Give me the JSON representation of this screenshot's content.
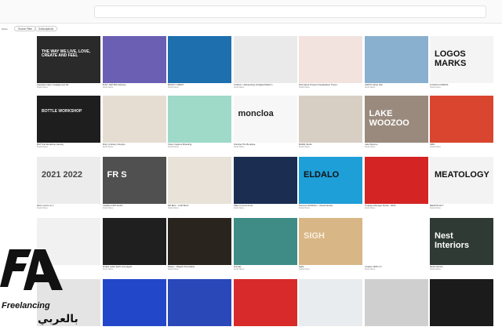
{
  "filters": {
    "left_label": "Show",
    "chip1": "Source Filter",
    "chip2": "Subscriptions"
  },
  "rows": [
    [
      {
        "icon": "collage-quote-image",
        "cap": "Aspiration take nostalgia and fell",
        "sub": "Studio Name",
        "bg": "#2a2a2a",
        "text": "THE WAY WE LIVE, LOVE, CREATE AND FEEL",
        "fg": "#ffffff"
      },
      {
        "icon": "packaging-image",
        "cap": "BUSY SET BIG Delivery",
        "sub": "Studio Name",
        "bg": "#6a5fb3",
        "text": "",
        "fg": "#fff"
      },
      {
        "icon": "business-cards-image",
        "cap": "BOOSY CREST",
        "sub": "Studio Name",
        "bg": "#1d6fae",
        "text": "",
        "fg": "#fff"
      },
      {
        "icon": "social-posts-image",
        "cap": "CODA K • Rebranding & Digital Platform",
        "sub": "Studio Name",
        "bg": "#eaeaea",
        "text": "",
        "fg": "#222"
      },
      {
        "icon": "product-render-image",
        "cap": "Pink Mood Product Visualization Travel",
        "sub": "Studio Name",
        "bg": "#f2e3df",
        "text": "",
        "fg": "#222"
      },
      {
        "icon": "street-building-image",
        "cap": "DAPFS Urban Hits",
        "sub": "Studio Name",
        "bg": "#8ab0cf",
        "text": "",
        "fg": "#fff"
      },
      {
        "icon": "logos-marks-image",
        "cap": "LOGOS & MARKS",
        "sub": "Studio Name",
        "bg": "#f4f4f4",
        "text": "LOGOS MARKS",
        "fg": "#111"
      }
    ],
    [
      {
        "icon": "workshop-image",
        "cap": "BOTTLE Workshop Identity",
        "sub": "Studio Name",
        "bg": "#1e1e1e",
        "text": "BOTTLE WORKSHOP",
        "fg": "#eeeeee"
      },
      {
        "icon": "ceramics-image",
        "cap": "Shiny Culinary Lifestyle",
        "sub": "Studio Name",
        "bg": "#e6ddd2",
        "text": "",
        "fg": "#222"
      },
      {
        "icon": "mascot-image",
        "cap": "Vision Capture Branding",
        "sub": "Studio Name",
        "bg": "#9fd9c8",
        "text": "",
        "fg": "#222"
      },
      {
        "icon": "moncloa-logo-image",
        "cap": "Moncloa The Boutique",
        "sub": "Studio Name",
        "bg": "#f7f7f7",
        "text": "moncloa",
        "fg": "#222"
      },
      {
        "icon": "jars-image",
        "cap": "MADE Studio",
        "sub": "Studio Name",
        "bg": "#d8cfc4",
        "text": "",
        "fg": "#222"
      },
      {
        "icon": "lake-woozoo-image",
        "cap": "Lake Woozoo",
        "sub": "Studio Name",
        "bg": "#9a8a7d",
        "text": "LAKE WOOZOO",
        "fg": "#ffffff"
      },
      {
        "icon": "phone-app-image",
        "cap": "SMS",
        "sub": "Studio Name",
        "bg": "#d9452e",
        "text": "",
        "fg": "#fff"
      }
    ],
    [
      {
        "icon": "year-circle-image",
        "cap": "2021 events on 1",
        "sub": "Studio Name",
        "bg": "#ececec",
        "text": "2021 2022",
        "fg": "#444"
      },
      {
        "icon": "frs-logo-image",
        "cap": "Facilities FRS Studio",
        "sub": "Studio Name",
        "bg": "#505050",
        "text": "FR S",
        "fg": "#ffffff"
      },
      {
        "icon": "book-spread-image",
        "cap": "NR Best - Craft Book",
        "sub": "Studio Name",
        "bg": "#e8e2d8",
        "text": "",
        "fg": "#222"
      },
      {
        "icon": "pattern-cards-image",
        "cap": "Make It Come Fund",
        "sub": "Studio Name",
        "bg": "#1c2d52",
        "text": "",
        "fg": "#fff"
      },
      {
        "icon": "poster-image",
        "cap": "Summer Exhibition - Visual Identity",
        "sub": "Studio Name",
        "bg": "#1e9fd8",
        "text": "ELDALO",
        "fg": "#111"
      },
      {
        "icon": "red-form-image",
        "cap": "Prokapred Design Studio - 2023",
        "sub": "Studio Name",
        "bg": "#d42424",
        "text": "",
        "fg": "#fff"
      },
      {
        "icon": "meatology-image",
        "cap": "MEATOLOGY",
        "sub": "Studio Name",
        "bg": "#f3f3f3",
        "text": "MEATOLOGY",
        "fg": "#111"
      }
    ],
    [
      {
        "icon": "glass-image",
        "cap": "Gift",
        "sub": "Studio Name",
        "bg": "#f1f1f1",
        "text": "",
        "fg": "#222"
      },
      {
        "icon": "bottle-label-image",
        "cap": "Bottled Label Spirit Leveraged",
        "sub": "Studio Name",
        "bg": "#1f1f1f",
        "text": "",
        "fg": "#eee"
      },
      {
        "icon": "dark-bottles-image",
        "cap": "Nasoo - Magick Chocolatier",
        "sub": "Studio Name",
        "bg": "#2a241f",
        "text": "",
        "fg": "#eee"
      },
      {
        "icon": "textile-pattern-image",
        "cap": "Animals",
        "sub": "Studio Name",
        "bg": "#3f8c86",
        "text": "",
        "fg": "#fff"
      },
      {
        "icon": "sign-box-image",
        "cap": "Sight",
        "sub": "Studio Name",
        "bg": "#d9b685",
        "text": "SIGH",
        "fg": "#f7efe0"
      },
      {
        "icon": "q-logo-image",
        "cap": "Creative SMS 2.0",
        "sub": "Studio Name",
        "bg": "#ffffff",
        "text": "",
        "fg": "#111"
      },
      {
        "icon": "nest-interiors-image",
        "cap": "Nest Interiors",
        "sub": "Studio Name",
        "bg": "#2e3a33",
        "text": "Nest Interiors",
        "fg": "#ffffff"
      }
    ],
    [
      {
        "icon": "frame-image",
        "cap": "",
        "sub": "",
        "bg": "#e4e4e4",
        "text": "",
        "fg": "#222"
      },
      {
        "icon": "blue-grid-image",
        "cap": "",
        "sub": "",
        "bg": "#2248c9",
        "text": "",
        "fg": "#fff"
      },
      {
        "icon": "illustration-image",
        "cap": "",
        "sub": "",
        "bg": "#2b48b8",
        "text": "",
        "fg": "#fff"
      },
      {
        "icon": "red-poster-image",
        "cap": "",
        "sub": "",
        "bg": "#d82a2a",
        "text": "",
        "fg": "#fff"
      },
      {
        "icon": "tshirt-image",
        "cap": "",
        "sub": "",
        "bg": "#e9ecef",
        "text": "",
        "fg": "#222"
      },
      {
        "icon": "signage-image",
        "cap": "",
        "sub": "",
        "bg": "#cfcfcf",
        "text": "",
        "fg": "#222"
      },
      {
        "icon": "black-shirt-image",
        "cap": "",
        "sub": "",
        "bg": "#1b1b1b",
        "text": "",
        "fg": "#fff"
      }
    ]
  ],
  "watermark": {
    "brand": "Freelancing",
    "arabic": "بالعربي",
    "icon": "fa-logo-image"
  }
}
